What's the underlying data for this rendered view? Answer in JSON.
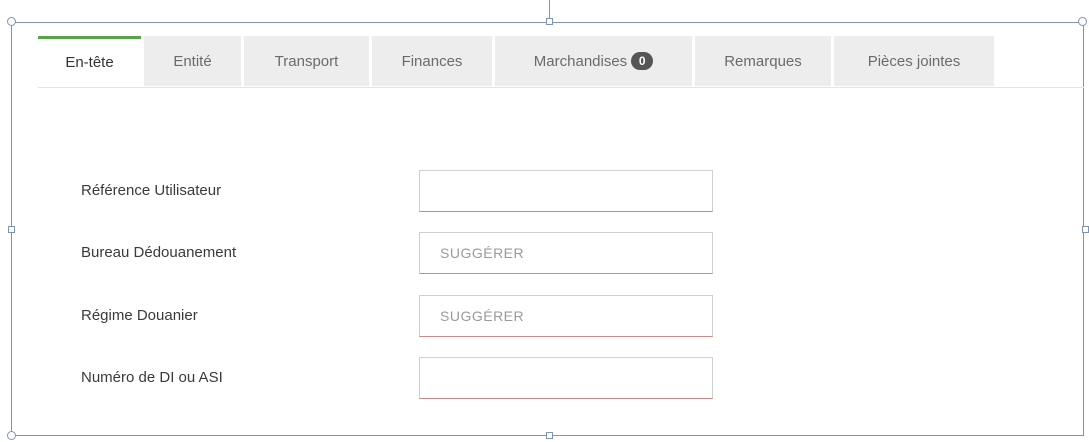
{
  "tabs": [
    {
      "label": "En-tête",
      "active": true
    },
    {
      "label": "Entité"
    },
    {
      "label": "Transport"
    },
    {
      "label": "Finances"
    },
    {
      "label": "Marchandises",
      "badge": "0"
    },
    {
      "label": "Remarques"
    },
    {
      "label": "Pièces jointes"
    }
  ],
  "form": {
    "reference_label": "Référence Utilisateur",
    "reference_value": "",
    "bureau_label": "Bureau Dédouanement",
    "bureau_placeholder": "SUGGÉRER",
    "regime_label": "Régime Douanier",
    "regime_placeholder": "SUGGÉRER",
    "numero_label": "Numéro de DI ou ASI",
    "numero_value": ""
  },
  "colors": {
    "active_tab_accent": "#5aa447",
    "tab_background": "#ededed",
    "badge_background": "#555555",
    "field_bottom_border": "#c98a8a"
  }
}
